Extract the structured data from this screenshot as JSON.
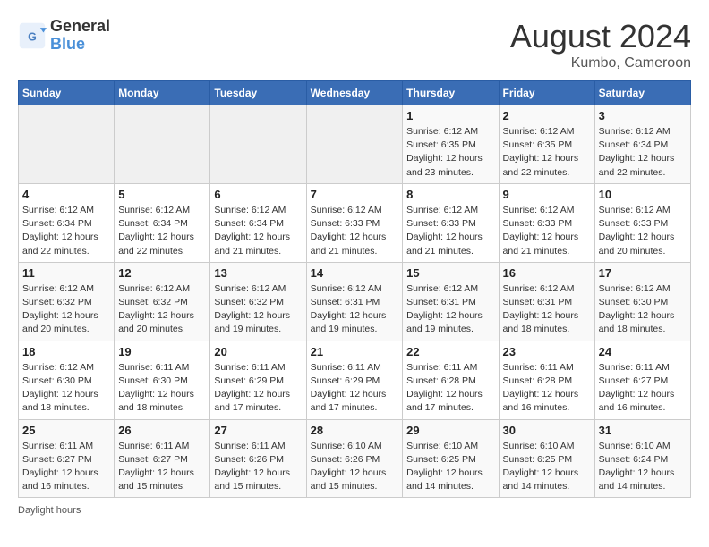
{
  "header": {
    "logo_general": "General",
    "logo_blue": "Blue",
    "title": "August 2024",
    "subtitle": "Kumbo, Cameroon"
  },
  "days_of_week": [
    "Sunday",
    "Monday",
    "Tuesday",
    "Wednesday",
    "Thursday",
    "Friday",
    "Saturday"
  ],
  "weeks": [
    [
      {
        "day": "",
        "info": ""
      },
      {
        "day": "",
        "info": ""
      },
      {
        "day": "",
        "info": ""
      },
      {
        "day": "",
        "info": ""
      },
      {
        "day": "1",
        "info": "Sunrise: 6:12 AM\nSunset: 6:35 PM\nDaylight: 12 hours and 23 minutes."
      },
      {
        "day": "2",
        "info": "Sunrise: 6:12 AM\nSunset: 6:35 PM\nDaylight: 12 hours and 22 minutes."
      },
      {
        "day": "3",
        "info": "Sunrise: 6:12 AM\nSunset: 6:34 PM\nDaylight: 12 hours and 22 minutes."
      }
    ],
    [
      {
        "day": "4",
        "info": "Sunrise: 6:12 AM\nSunset: 6:34 PM\nDaylight: 12 hours and 22 minutes."
      },
      {
        "day": "5",
        "info": "Sunrise: 6:12 AM\nSunset: 6:34 PM\nDaylight: 12 hours and 22 minutes."
      },
      {
        "day": "6",
        "info": "Sunrise: 6:12 AM\nSunset: 6:34 PM\nDaylight: 12 hours and 21 minutes."
      },
      {
        "day": "7",
        "info": "Sunrise: 6:12 AM\nSunset: 6:33 PM\nDaylight: 12 hours and 21 minutes."
      },
      {
        "day": "8",
        "info": "Sunrise: 6:12 AM\nSunset: 6:33 PM\nDaylight: 12 hours and 21 minutes."
      },
      {
        "day": "9",
        "info": "Sunrise: 6:12 AM\nSunset: 6:33 PM\nDaylight: 12 hours and 21 minutes."
      },
      {
        "day": "10",
        "info": "Sunrise: 6:12 AM\nSunset: 6:33 PM\nDaylight: 12 hours and 20 minutes."
      }
    ],
    [
      {
        "day": "11",
        "info": "Sunrise: 6:12 AM\nSunset: 6:32 PM\nDaylight: 12 hours and 20 minutes."
      },
      {
        "day": "12",
        "info": "Sunrise: 6:12 AM\nSunset: 6:32 PM\nDaylight: 12 hours and 20 minutes."
      },
      {
        "day": "13",
        "info": "Sunrise: 6:12 AM\nSunset: 6:32 PM\nDaylight: 12 hours and 19 minutes."
      },
      {
        "day": "14",
        "info": "Sunrise: 6:12 AM\nSunset: 6:31 PM\nDaylight: 12 hours and 19 minutes."
      },
      {
        "day": "15",
        "info": "Sunrise: 6:12 AM\nSunset: 6:31 PM\nDaylight: 12 hours and 19 minutes."
      },
      {
        "day": "16",
        "info": "Sunrise: 6:12 AM\nSunset: 6:31 PM\nDaylight: 12 hours and 18 minutes."
      },
      {
        "day": "17",
        "info": "Sunrise: 6:12 AM\nSunset: 6:30 PM\nDaylight: 12 hours and 18 minutes."
      }
    ],
    [
      {
        "day": "18",
        "info": "Sunrise: 6:12 AM\nSunset: 6:30 PM\nDaylight: 12 hours and 18 minutes."
      },
      {
        "day": "19",
        "info": "Sunrise: 6:11 AM\nSunset: 6:30 PM\nDaylight: 12 hours and 18 minutes."
      },
      {
        "day": "20",
        "info": "Sunrise: 6:11 AM\nSunset: 6:29 PM\nDaylight: 12 hours and 17 minutes."
      },
      {
        "day": "21",
        "info": "Sunrise: 6:11 AM\nSunset: 6:29 PM\nDaylight: 12 hours and 17 minutes."
      },
      {
        "day": "22",
        "info": "Sunrise: 6:11 AM\nSunset: 6:28 PM\nDaylight: 12 hours and 17 minutes."
      },
      {
        "day": "23",
        "info": "Sunrise: 6:11 AM\nSunset: 6:28 PM\nDaylight: 12 hours and 16 minutes."
      },
      {
        "day": "24",
        "info": "Sunrise: 6:11 AM\nSunset: 6:27 PM\nDaylight: 12 hours and 16 minutes."
      }
    ],
    [
      {
        "day": "25",
        "info": "Sunrise: 6:11 AM\nSunset: 6:27 PM\nDaylight: 12 hours and 16 minutes."
      },
      {
        "day": "26",
        "info": "Sunrise: 6:11 AM\nSunset: 6:27 PM\nDaylight: 12 hours and 15 minutes."
      },
      {
        "day": "27",
        "info": "Sunrise: 6:11 AM\nSunset: 6:26 PM\nDaylight: 12 hours and 15 minutes."
      },
      {
        "day": "28",
        "info": "Sunrise: 6:10 AM\nSunset: 6:26 PM\nDaylight: 12 hours and 15 minutes."
      },
      {
        "day": "29",
        "info": "Sunrise: 6:10 AM\nSunset: 6:25 PM\nDaylight: 12 hours and 14 minutes."
      },
      {
        "day": "30",
        "info": "Sunrise: 6:10 AM\nSunset: 6:25 PM\nDaylight: 12 hours and 14 minutes."
      },
      {
        "day": "31",
        "info": "Sunrise: 6:10 AM\nSunset: 6:24 PM\nDaylight: 12 hours and 14 minutes."
      }
    ]
  ],
  "footer": {
    "daylight_label": "Daylight hours"
  }
}
